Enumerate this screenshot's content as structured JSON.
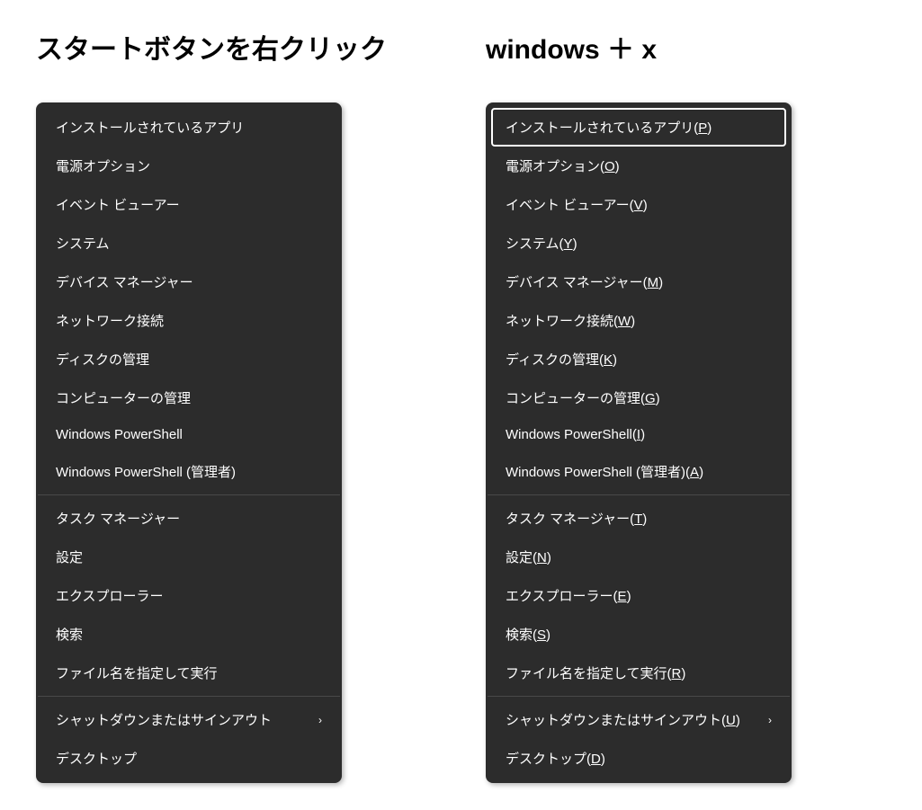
{
  "left": {
    "heading": "スタートボタンを右クリック",
    "groups": [
      [
        {
          "label": "インストールされているアプリ",
          "submenu": false
        },
        {
          "label": "電源オプション",
          "submenu": false
        },
        {
          "label": "イベント ビューアー",
          "submenu": false
        },
        {
          "label": "システム",
          "submenu": false
        },
        {
          "label": "デバイス マネージャー",
          "submenu": false
        },
        {
          "label": "ネットワーク接続",
          "submenu": false
        },
        {
          "label": "ディスクの管理",
          "submenu": false
        },
        {
          "label": "コンピューターの管理",
          "submenu": false
        },
        {
          "label": "Windows PowerShell",
          "submenu": false
        },
        {
          "label": "Windows PowerShell (管理者)",
          "submenu": false
        }
      ],
      [
        {
          "label": "タスク マネージャー",
          "submenu": false
        },
        {
          "label": "設定",
          "submenu": false
        },
        {
          "label": "エクスプローラー",
          "submenu": false
        },
        {
          "label": "検索",
          "submenu": false
        },
        {
          "label": "ファイル名を指定して実行",
          "submenu": false
        }
      ],
      [
        {
          "label": "シャットダウンまたはサインアウト",
          "submenu": true
        },
        {
          "label": "デスクトップ",
          "submenu": false
        }
      ]
    ]
  },
  "right": {
    "heading": "windows ＋ x",
    "groups": [
      [
        {
          "label": "インストールされているアプリ",
          "accel": "P",
          "submenu": false,
          "highlighted": true
        },
        {
          "label": "電源オプション",
          "accel": "O",
          "submenu": false
        },
        {
          "label": "イベント ビューアー",
          "accel": "V",
          "submenu": false
        },
        {
          "label": "システム",
          "accel": "Y",
          "submenu": false
        },
        {
          "label": "デバイス マネージャー",
          "accel": "M",
          "submenu": false
        },
        {
          "label": "ネットワーク接続",
          "accel": "W",
          "submenu": false
        },
        {
          "label": "ディスクの管理",
          "accel": "K",
          "submenu": false
        },
        {
          "label": "コンピューターの管理",
          "accel": "G",
          "submenu": false
        },
        {
          "label": "Windows PowerShell",
          "accel": "I",
          "submenu": false
        },
        {
          "label": "Windows PowerShell (管理者)",
          "accel": "A",
          "submenu": false
        }
      ],
      [
        {
          "label": "タスク マネージャー",
          "accel": "T",
          "submenu": false
        },
        {
          "label": "設定",
          "accel": "N",
          "submenu": false
        },
        {
          "label": "エクスプローラー",
          "accel": "E",
          "submenu": false
        },
        {
          "label": "検索",
          "accel": "S",
          "submenu": false
        },
        {
          "label": "ファイル名を指定して実行",
          "accel": "R",
          "submenu": false
        }
      ],
      [
        {
          "label": "シャットダウンまたはサインアウト",
          "accel": "U",
          "submenu": true
        },
        {
          "label": "デスクトップ",
          "accel": "D",
          "submenu": false
        }
      ]
    ]
  }
}
